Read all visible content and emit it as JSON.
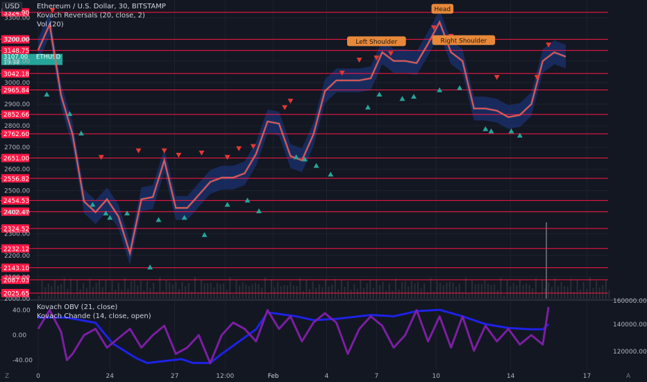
{
  "header": {
    "currency": "USD",
    "title": "Ethereum / U.S. Dollar, 30, BITSTAMP",
    "indicator1": "Kovach Reversals (20, close, 2)",
    "indicator2": "Vol (20)"
  },
  "subpane": {
    "legend1": "Kovach OBV (21, close)",
    "legend2": "Kovach Chande (14, close, open)"
  },
  "corner_labels": {
    "bottom_left": "Z",
    "bottom_right": "A"
  },
  "colors": {
    "background": "#131722",
    "level_line": "#ff1744",
    "price_line": "#ef5350",
    "band": "#1e3a8a",
    "obv": "#1e22e8",
    "chande": "#7b1fa2",
    "ethusd_tag": "#26a69a",
    "annotation": "#e8893a",
    "up_marker": "#26a69a",
    "down_marker": "#e53935"
  },
  "chart_data": [
    {
      "type": "line",
      "title": "Ethereum / U.S. Dollar, 30, BITSTAMP",
      "ylim": [
        2000,
        3350
      ],
      "x_ticks": [
        "0",
        "24",
        "27",
        "12:00",
        "Feb",
        "4",
        "7",
        "10",
        "14",
        "17"
      ],
      "y_ticks": [
        2000,
        2100,
        2200,
        2300,
        2400,
        2500,
        2600,
        2700,
        2800,
        2900,
        3000,
        3100,
        3200,
        3300
      ],
      "y_tick_labels": [
        "2000.00",
        "2100.00",
        "2200.00",
        "2300.00",
        "2400.00",
        "2500.00",
        "2600.00",
        "2700.00",
        "2800.00",
        "2900.00",
        "3000.00",
        "3100.00",
        "3200.00",
        "3300.00"
      ],
      "level_lines": [
        3416.79,
        3324.9,
        3200.0,
        3148.75,
        3042.18,
        2965.84,
        2852.66,
        2762.6,
        2651.0,
        2556.82,
        2454.53,
        2402.47,
        2324.52,
        2232.12,
        2143.1,
        2087.03,
        2025.65
      ],
      "level_labels": [
        "3416.79",
        "3324.90",
        "3200.00",
        "3148.75",
        "3042.18",
        "2965.84",
        "2852.66",
        "2762.60",
        "2651.00",
        "2556.82",
        "2454.53",
        "2402.47",
        "2324.52",
        "2232.12",
        "2143.10",
        "2087.03",
        "2025.65"
      ],
      "last_price": {
        "label": "ETHUSD",
        "value": "3107.00",
        "countdown": "13:38"
      },
      "annotations": [
        {
          "label": "Left Shoulder",
          "x": 0.59,
          "y": 3140
        },
        {
          "label": "Head",
          "x": 0.705,
          "y": 3290
        },
        {
          "label": "Right Shoulder",
          "x": 0.742,
          "y": 3145
        }
      ],
      "series": [
        {
          "x": [
            0.0,
            0.02,
            0.04,
            0.06,
            0.08,
            0.1,
            0.12,
            0.14,
            0.16,
            0.18,
            0.2,
            0.22,
            0.24,
            0.26,
            0.28,
            0.3,
            0.32,
            0.34,
            0.36,
            0.38,
            0.4,
            0.42,
            0.44,
            0.46,
            0.48,
            0.5,
            0.52,
            0.54,
            0.56,
            0.58,
            0.6,
            0.62,
            0.64,
            0.66,
            0.68,
            0.7,
            0.72,
            0.74,
            0.76,
            0.78,
            0.8,
            0.82,
            0.84,
            0.86,
            0.88,
            0.9,
            0.92
          ],
          "values": [
            3150,
            3270,
            2940,
            2760,
            2450,
            2400,
            2460,
            2380,
            2210,
            2460,
            2470,
            2640,
            2420,
            2420,
            2480,
            2540,
            2560,
            2560,
            2580,
            2670,
            2820,
            2810,
            2660,
            2640,
            2760,
            2960,
            3010,
            3010,
            3010,
            3020,
            3140,
            3100,
            3100,
            3090,
            3180,
            3280,
            3140,
            3100,
            2880,
            2880,
            2870,
            2840,
            2850,
            2900,
            3100,
            3140,
            3120
          ]
        }
      ],
      "up_markers": [
        [
          0.015,
          2990
        ],
        [
          0.055,
          2900
        ],
        [
          0.075,
          2810
        ],
        [
          0.095,
          2480
        ],
        [
          0.118,
          2440
        ],
        [
          0.125,
          2420
        ],
        [
          0.155,
          2440
        ],
        [
          0.195,
          2190
        ],
        [
          0.21,
          2410
        ],
        [
          0.255,
          2420
        ],
        [
          0.29,
          2340
        ],
        [
          0.33,
          2480
        ],
        [
          0.365,
          2500
        ],
        [
          0.385,
          2450
        ],
        [
          0.45,
          2700
        ],
        [
          0.465,
          2690
        ],
        [
          0.485,
          2660
        ],
        [
          0.51,
          2620
        ],
        [
          0.575,
          2930
        ],
        [
          0.595,
          2990
        ],
        [
          0.635,
          2970
        ],
        [
          0.655,
          2980
        ],
        [
          0.7,
          3010
        ],
        [
          0.735,
          3020
        ],
        [
          0.78,
          2830
        ],
        [
          0.79,
          2820
        ],
        [
          0.825,
          2820
        ],
        [
          0.84,
          2800
        ]
      ],
      "down_markers": [
        [
          0.025,
          3300
        ],
        [
          0.11,
          2620
        ],
        [
          0.175,
          2650
        ],
        [
          0.22,
          2650
        ],
        [
          0.245,
          2630
        ],
        [
          0.285,
          2640
        ],
        [
          0.33,
          2620
        ],
        [
          0.35,
          2660
        ],
        [
          0.375,
          2670
        ],
        [
          0.43,
          2850
        ],
        [
          0.44,
          2880
        ],
        [
          0.53,
          3010
        ],
        [
          0.56,
          3070
        ],
        [
          0.59,
          3080
        ],
        [
          0.615,
          3100
        ],
        [
          0.69,
          3220
        ],
        [
          0.72,
          3180
        ],
        [
          0.8,
          2990
        ],
        [
          0.87,
          2990
        ],
        [
          0.89,
          3140
        ]
      ],
      "volume_axis": {
        "ticks": [
          "160000.00",
          "140000.00",
          "120000.00"
        ]
      }
    },
    {
      "type": "line",
      "title": "Kovach OBV (21, close) / Kovach Chande (14, close, open)",
      "ylim": [
        -55,
        55
      ],
      "y_ticks": [
        40,
        0,
        -40
      ],
      "y_tick_labels": [
        "40.00",
        "0.00",
        "-40.00"
      ],
      "right_axis": {
        "ticks": [
          "160000.00",
          "140000.00",
          "120000.00"
        ]
      },
      "series": [
        {
          "name": "Kovach OBV (21, close)",
          "x": [
            0.0,
            0.05,
            0.1,
            0.13,
            0.17,
            0.19,
            0.21,
            0.25,
            0.27,
            0.3,
            0.32,
            0.38,
            0.4,
            0.45,
            0.48,
            0.52,
            0.58,
            0.62,
            0.66,
            0.7,
            0.74,
            0.76,
            0.78,
            0.82,
            0.86,
            0.88,
            0.89
          ],
          "values": [
            152000,
            152000,
            148000,
            132000,
            121000,
            117000,
            118000,
            120000,
            117000,
            117000,
            124000,
            143000,
            156000,
            153000,
            150000,
            151000,
            154000,
            153000,
            157000,
            158000,
            153000,
            150000,
            147000,
            144000,
            143000,
            143000,
            147000
          ]
        },
        {
          "name": "Kovach Chande (14, close, open)",
          "x": [
            0.0,
            0.02,
            0.04,
            0.05,
            0.06,
            0.08,
            0.1,
            0.12,
            0.14,
            0.16,
            0.18,
            0.2,
            0.22,
            0.24,
            0.26,
            0.28,
            0.3,
            0.32,
            0.34,
            0.36,
            0.38,
            0.4,
            0.42,
            0.44,
            0.46,
            0.48,
            0.5,
            0.52,
            0.54,
            0.56,
            0.58,
            0.6,
            0.62,
            0.64,
            0.66,
            0.68,
            0.7,
            0.72,
            0.74,
            0.76,
            0.78,
            0.8,
            0.82,
            0.84,
            0.86,
            0.88,
            0.89
          ],
          "values": [
            10,
            40,
            5,
            -40,
            -30,
            0,
            10,
            -20,
            -5,
            10,
            -20,
            0,
            15,
            -30,
            -20,
            0,
            -45,
            0,
            20,
            10,
            -10,
            40,
            10,
            30,
            -10,
            20,
            35,
            20,
            -30,
            10,
            30,
            15,
            -20,
            0,
            40,
            -10,
            30,
            -20,
            30,
            -25,
            15,
            -10,
            10,
            -15,
            0,
            -15,
            45
          ]
        }
      ]
    }
  ]
}
